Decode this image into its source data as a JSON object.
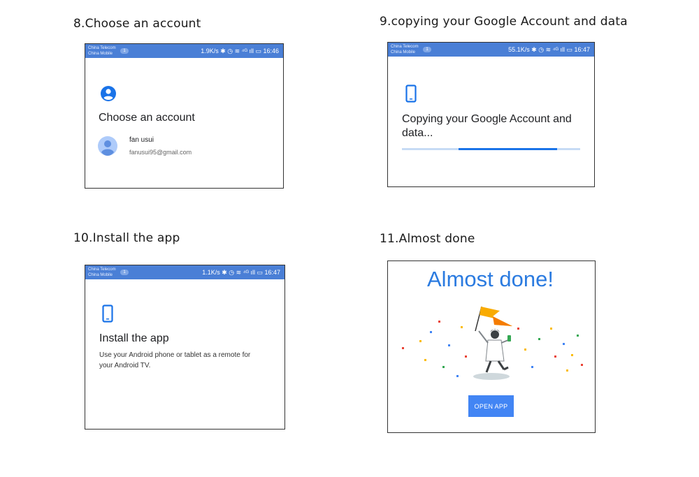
{
  "steps": [
    {
      "title": "8.Choose an account",
      "status": {
        "carrier1": "China Telecom",
        "carrier2": "China Mobile",
        "badge": "1",
        "right": "1.9K/s ✱ ◷ ≋ ⁴ᴳ ıll ▭ 16:46"
      },
      "heading": "Choose an account",
      "account_name": "fan usui",
      "account_email": "fanusui95@gmail.com",
      "icons": [
        "account-circle-icon",
        "avatar-icon"
      ]
    },
    {
      "title": "9.copying your Google Account and data",
      "status": {
        "carrier1": "China Telecom",
        "carrier2": "China Mobile",
        "badge": "1",
        "right": "55.1K/s ✱ ◷ ≋ ⁴ᴳ ıll ▭ 16:47"
      },
      "heading_line1": "Copying your Google Account and",
      "heading_line2": "data...",
      "progress": 0.7,
      "icons": [
        "phone-icon"
      ]
    },
    {
      "title": "10.Install the app",
      "status": {
        "carrier1": "China Telecom",
        "carrier2": "China Mobile",
        "badge": "1",
        "right": "1.1K/s ✱ ◷ ≋ ⁴ᴳ ıll ▭ 16:47"
      },
      "heading": "Install the app",
      "desc_line1": "Use your Android phone or tablet as a remote for",
      "desc_line2": "your Android TV.",
      "icons": [
        "phone-icon"
      ]
    },
    {
      "title": "11.Almost done",
      "heading": "Almost done!",
      "button": "OPEN APP",
      "icons": [
        "celebration-illustration"
      ]
    }
  ],
  "colors": {
    "statusbar": "#4a7fd6",
    "accent": "#1a73e8",
    "done_title": "#2b7be0",
    "button": "#4285f4"
  }
}
